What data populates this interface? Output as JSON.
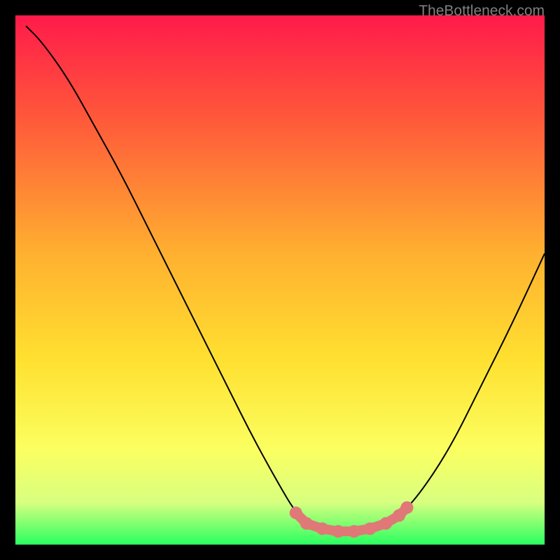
{
  "watermark": "TheBottleneck.com",
  "chart_data": {
    "type": "line",
    "title": "",
    "xlabel": "",
    "ylabel": "",
    "xlim": [
      0,
      100
    ],
    "ylim": [
      0,
      100
    ],
    "background_gradient": {
      "stops": [
        {
          "offset": 0,
          "color": "#ff1a4a"
        },
        {
          "offset": 20,
          "color": "#ff5a3a"
        },
        {
          "offset": 45,
          "color": "#ffb030"
        },
        {
          "offset": 65,
          "color": "#ffe030"
        },
        {
          "offset": 82,
          "color": "#fbff60"
        },
        {
          "offset": 92,
          "color": "#d8ff80"
        },
        {
          "offset": 100,
          "color": "#2aff60"
        }
      ]
    },
    "series": [
      {
        "name": "bottleneck-curve",
        "color": "#000000",
        "type": "line",
        "points": [
          {
            "x": 2,
            "y": 98
          },
          {
            "x": 5,
            "y": 95
          },
          {
            "x": 10,
            "y": 88
          },
          {
            "x": 15,
            "y": 79
          },
          {
            "x": 20,
            "y": 70
          },
          {
            "x": 25,
            "y": 60
          },
          {
            "x": 30,
            "y": 50
          },
          {
            "x": 35,
            "y": 40
          },
          {
            "x": 40,
            "y": 30
          },
          {
            "x": 45,
            "y": 20
          },
          {
            "x": 50,
            "y": 11
          },
          {
            "x": 53,
            "y": 6
          },
          {
            "x": 56,
            "y": 3.5
          },
          {
            "x": 60,
            "y": 2.5
          },
          {
            "x": 64,
            "y": 2.5
          },
          {
            "x": 68,
            "y": 3
          },
          {
            "x": 72,
            "y": 5
          },
          {
            "x": 76,
            "y": 9
          },
          {
            "x": 82,
            "y": 18
          },
          {
            "x": 88,
            "y": 30
          },
          {
            "x": 94,
            "y": 42
          },
          {
            "x": 100,
            "y": 55
          }
        ]
      },
      {
        "name": "optimal-markers",
        "color": "#e07878",
        "type": "scatter",
        "points": [
          {
            "x": 53,
            "y": 6
          },
          {
            "x": 55,
            "y": 4
          },
          {
            "x": 58,
            "y": 3
          },
          {
            "x": 61,
            "y": 2.5
          },
          {
            "x": 64,
            "y": 2.5
          },
          {
            "x": 67,
            "y": 3
          },
          {
            "x": 70,
            "y": 4
          },
          {
            "x": 72.5,
            "y": 5.5
          },
          {
            "x": 74,
            "y": 7
          }
        ]
      }
    ]
  }
}
